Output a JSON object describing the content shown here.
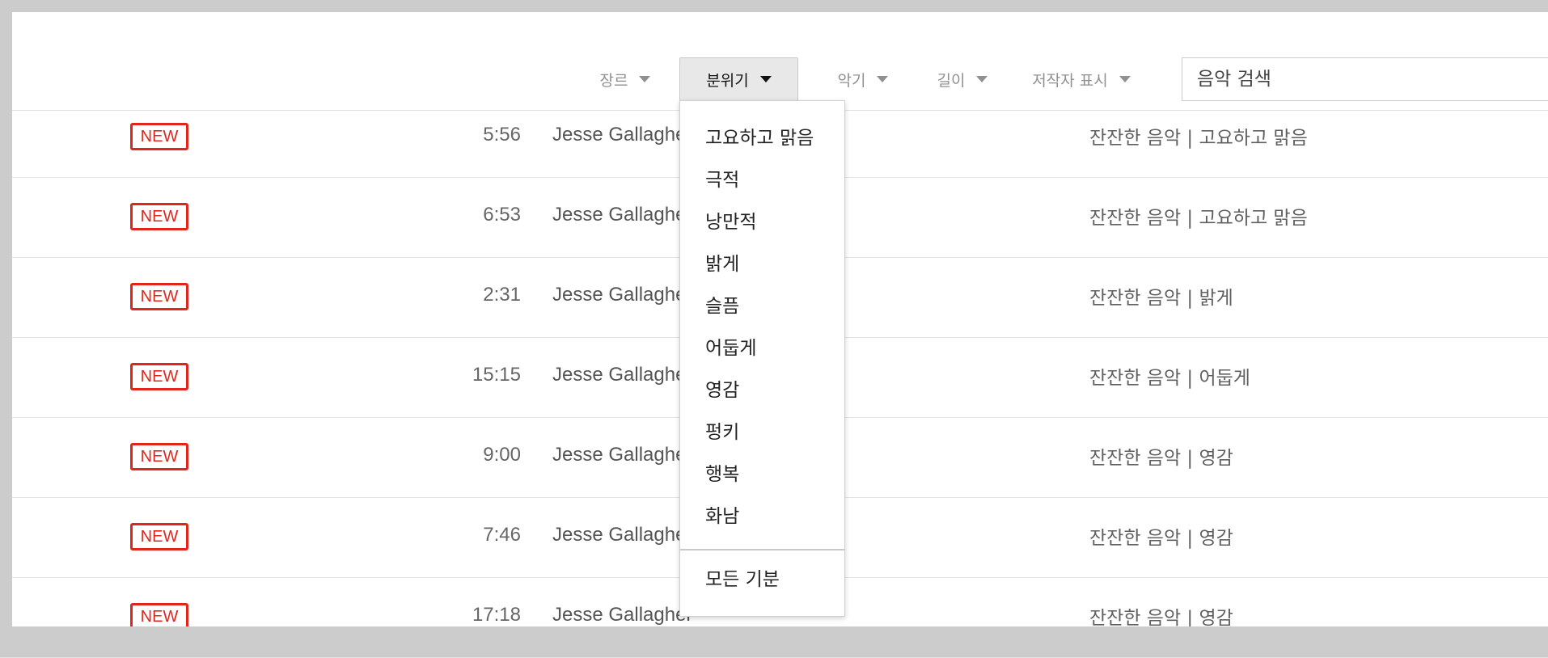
{
  "frame_corner_text": "…",
  "filters": {
    "genre": {
      "label": "장르"
    },
    "mood": {
      "label": "분위기"
    },
    "instrument": {
      "label": "악기"
    },
    "length": {
      "label": "길이"
    },
    "attribution": {
      "label": "저작자 표시"
    }
  },
  "search": {
    "placeholder": "음악 검색"
  },
  "badges": {
    "new": "NEW"
  },
  "tracks": [
    {
      "duration": "5:56",
      "artist": "Jesse Gallagher",
      "tags": "잔잔한 음악 | 고요하고 맑음"
    },
    {
      "duration": "6:53",
      "artist": "Jesse Gallagher",
      "tags": "잔잔한 음악 | 고요하고 맑음"
    },
    {
      "duration": "2:31",
      "artist": "Jesse Gallagher",
      "tags": "잔잔한 음악 | 밝게"
    },
    {
      "duration": "15:15",
      "artist": "Jesse Gallagher",
      "tags": "잔잔한 음악 | 어둡게"
    },
    {
      "duration": "9:00",
      "artist": "Jesse Gallagher",
      "tags": "잔잔한 음악 | 영감"
    },
    {
      "duration": "7:46",
      "artist": "Jesse Gallagher",
      "tags": "잔잔한 음악 | 영감"
    },
    {
      "duration": "17:18",
      "artist": "Jesse Gallagher",
      "tags": "잔잔한 음악 | 영감"
    }
  ],
  "mood_dropdown": {
    "items": [
      "고요하고 맑음",
      "극적",
      "낭만적",
      "밝게",
      "슬픔",
      "어둡게",
      "영감",
      "펑키",
      "행복",
      "화남"
    ],
    "all_label": "모든 기분"
  },
  "colors": {
    "new_badge": "#e1251b",
    "active_filter_bg": "#e8e8e8"
  }
}
